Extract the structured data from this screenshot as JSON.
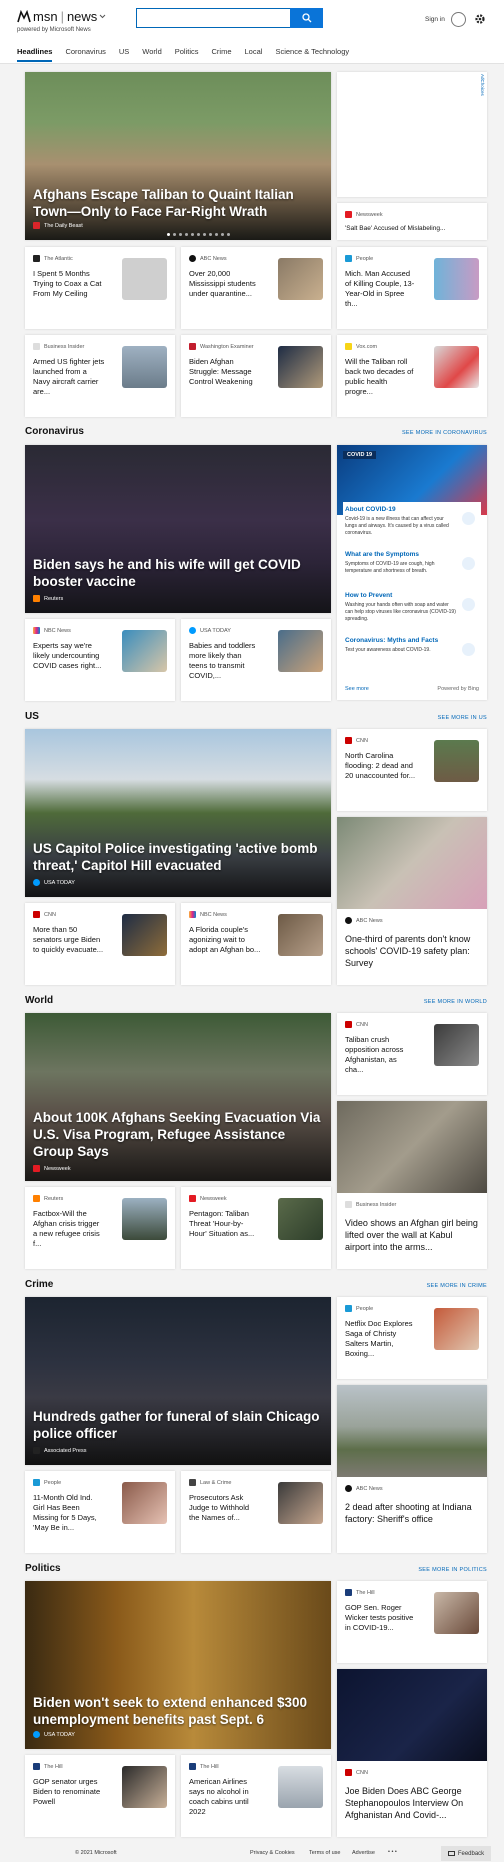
{
  "header": {
    "brand": "msn",
    "brand_section": "news",
    "powered": "powered by Microsoft News",
    "search": {
      "placeholder": ""
    },
    "signin": "Sign in"
  },
  "nav": [
    "Headlines",
    "Coronavirus",
    "US",
    "World",
    "Politics",
    "Crime",
    "Local",
    "Science & Technology"
  ],
  "ad": {
    "choices": "AdChoices"
  },
  "headlines": {
    "hero": {
      "title": "Afghans Escape Taliban to Quaint Italian Town—Only to Face Far-Right Wrath",
      "source": "The Daily Beast"
    },
    "side": {
      "source": "Newsweek",
      "title": "'Salt Bae' Accused of Mislabeling..."
    },
    "row1": [
      {
        "source": "The Atlantic",
        "title": "I Spent 5 Months Trying to Coax a Cat From My Ceiling"
      },
      {
        "source": "ABC News",
        "title": "Over 20,000 Mississippi students under quarantine..."
      },
      {
        "source": "People",
        "title": "Mich. Man Accused of Killing Couple, 13-Year-Old in Spree th..."
      }
    ],
    "row2": [
      {
        "source": "Business Insider",
        "title": "Armed US fighter jets launched from a Navy aircraft carrier are..."
      },
      {
        "source": "Washington Examiner",
        "title": "Biden Afghan Struggle: Message Control Weakening"
      },
      {
        "source": "Vox.com",
        "title": "Will the Taliban roll back two decades of public health progre..."
      }
    ]
  },
  "coronavirus": {
    "title": "Coronavirus",
    "see_more": "SEE MORE IN CORONAVIRUS",
    "hero": {
      "title": "Biden says he and his wife will get COVID booster vaccine",
      "source": "Reuters"
    },
    "panel": {
      "badge": "COVID 19",
      "items": [
        {
          "title": "About COVID-19",
          "desc": "Covid-19 is a new illness that can affect your lungs and airways. It's caused by a virus called coronavirus."
        },
        {
          "title": "What are the Symptoms",
          "desc": "Symptoms of COVID-19 are cough, high temperature and shortness of breath."
        },
        {
          "title": "How to Prevent",
          "desc": "Washing your hands often with soap and water can help stop viruses like coronavirus (COVID-19) spreading."
        },
        {
          "title": "Coronavirus: Myths and Facts",
          "desc": "Test your awareness about COVID-19."
        }
      ],
      "see_more": "See more",
      "powered": "Powered by Bing"
    },
    "small": [
      {
        "source": "NBC News",
        "title": "Experts say we're likely undercounting COVID cases right..."
      },
      {
        "source": "USA TODAY",
        "title": "Babies and toddlers more likely than teens to transmit COVID,..."
      }
    ]
  },
  "us": {
    "title": "US",
    "see_more": "SEE MORE IN US",
    "hero": {
      "title": "US Capitol Police investigating 'active bomb threat,' Capitol Hill evacuated",
      "source": "USA TODAY"
    },
    "side": {
      "source": "CNN",
      "title": "North Carolina flooding: 2 dead and 20 unaccounted for..."
    },
    "tall": {
      "source": "ABC News",
      "title": "One-third of parents don't know schools' COVID-19 safety plan: Survey"
    },
    "small": [
      {
        "source": "CNN",
        "title": "More than 50 senators urge Biden to quickly evacuate..."
      },
      {
        "source": "NBC News",
        "title": "A Florida couple's agonizing wait to adopt an Afghan bo..."
      }
    ]
  },
  "world": {
    "title": "World",
    "see_more": "SEE MORE IN WORLD",
    "hero": {
      "title": "About 100K Afghans Seeking Evacuation Via U.S. Visa Program, Refugee Assistance Group Says",
      "source": "Newsweek"
    },
    "side": {
      "source": "CNN",
      "title": "Taliban crush opposition across Afghanistan, as cha..."
    },
    "tall": {
      "source": "Business Insider",
      "title": "Video shows an Afghan girl being lifted over the wall at Kabul airport into the arms..."
    },
    "small": [
      {
        "source": "Reuters",
        "title": "Factbox-Will the Afghan crisis trigger a new refugee crisis f..."
      },
      {
        "source": "Newsweek",
        "title": "Pentagon: Taliban Threat 'Hour-by-Hour' Situation as..."
      }
    ]
  },
  "crime": {
    "title": "Crime",
    "see_more": "SEE MORE IN CRIME",
    "hero": {
      "title": "Hundreds gather for funeral of slain Chicago police officer",
      "source": "Associated Press"
    },
    "side": {
      "source": "People",
      "title": "Netflix Doc Explores Saga of Christy Salters Martin, Boxing..."
    },
    "tall": {
      "source": "ABC News",
      "title": "2 dead after shooting at Indiana factory: Sheriff's office"
    },
    "small": [
      {
        "source": "People",
        "title": "11-Month Old Ind. Girl Has Been Missing for 5 Days, 'May Be in..."
      },
      {
        "source": "Law & Crime",
        "title": "Prosecutors Ask Judge to Withhold the Names of..."
      }
    ]
  },
  "politics": {
    "title": "Politics",
    "see_more": "SEE MORE IN POLITICS",
    "hero": {
      "title": "Biden won't seek to extend enhanced $300 unemployment benefits past Sept. 6",
      "source": "USA TODAY"
    },
    "side": {
      "source": "The Hill",
      "title": "GOP Sen. Roger Wicker tests positive in COVID-19..."
    },
    "tall": {
      "source": "CNN",
      "title": "Joe Biden Does ABC George Stephanopoulos Interview On Afghanistan And Covid-..."
    },
    "small": [
      {
        "source": "The Hill",
        "title": "GOP senator urges Biden to renominate Powell"
      },
      {
        "source": "The Hill",
        "title": "American Airlines says no alcohol in coach cabins until 2022"
      }
    ]
  },
  "footer": {
    "copyright": "© 2021 Microsoft",
    "links": [
      "Privacy & Cookies",
      "Terms of use",
      "Advertise"
    ],
    "more": "• • •",
    "feedback": "Feedback"
  }
}
